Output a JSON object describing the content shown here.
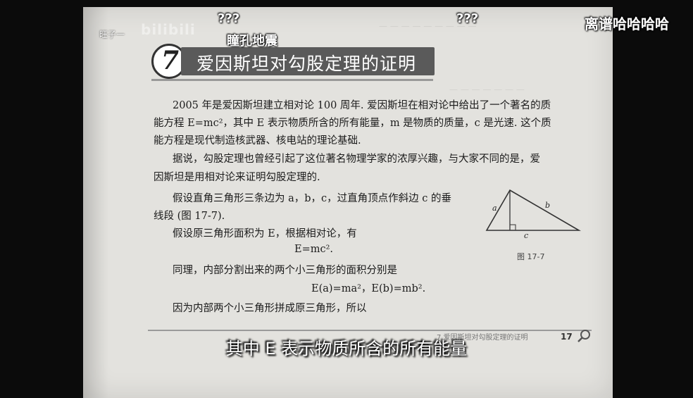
{
  "watermark": {
    "user": "旺子一",
    "logo": "bilibili"
  },
  "danmaku": [
    "???",
    "???",
    "离谱哈哈哈哈",
    "瞳孔地震"
  ],
  "book": {
    "section_number": "7",
    "title": "爱因斯坦对勾股定理的证明",
    "paragraphs": [
      "2005 年是爱因斯坦建立相对论 100 周年. 爱因斯坦在相对论中给出了一个著名的质",
      "能方程 E=mc²，其中 E 表示物质所含的所有能量，m 是物质的质量，c 是光速. 这个质",
      "能方程是现代制造核武器、核电站的理论基础.",
      "据说，勾股定理也曾经引起了这位著名物理学家的浓厚兴趣，与大家不同的是，爱",
      "因斯坦是用相对论来证明勾股定理的.",
      "假设直角三角形三条边为 a，b，c，过直角顶点作斜边 c 的垂",
      "线段 (图 17-7).",
      "假设原三角形面积为 E，根据相对论，有",
      "E=mc².",
      "同理，内部分割出来的两个小三角形的面积分别是",
      "E(a)=ma²，E(b)=mb².",
      "因为内部两个小三角形拼成原三角形，所以"
    ],
    "figure": {
      "labels": {
        "a": "a",
        "b": "b",
        "c": "c"
      },
      "caption": "图 17-7"
    },
    "footer": {
      "running_title": "7  爱因斯坦对勾股定理的证明",
      "page_number": "17"
    }
  },
  "subtitle": "其中 E 表示物质所含的所有能量"
}
